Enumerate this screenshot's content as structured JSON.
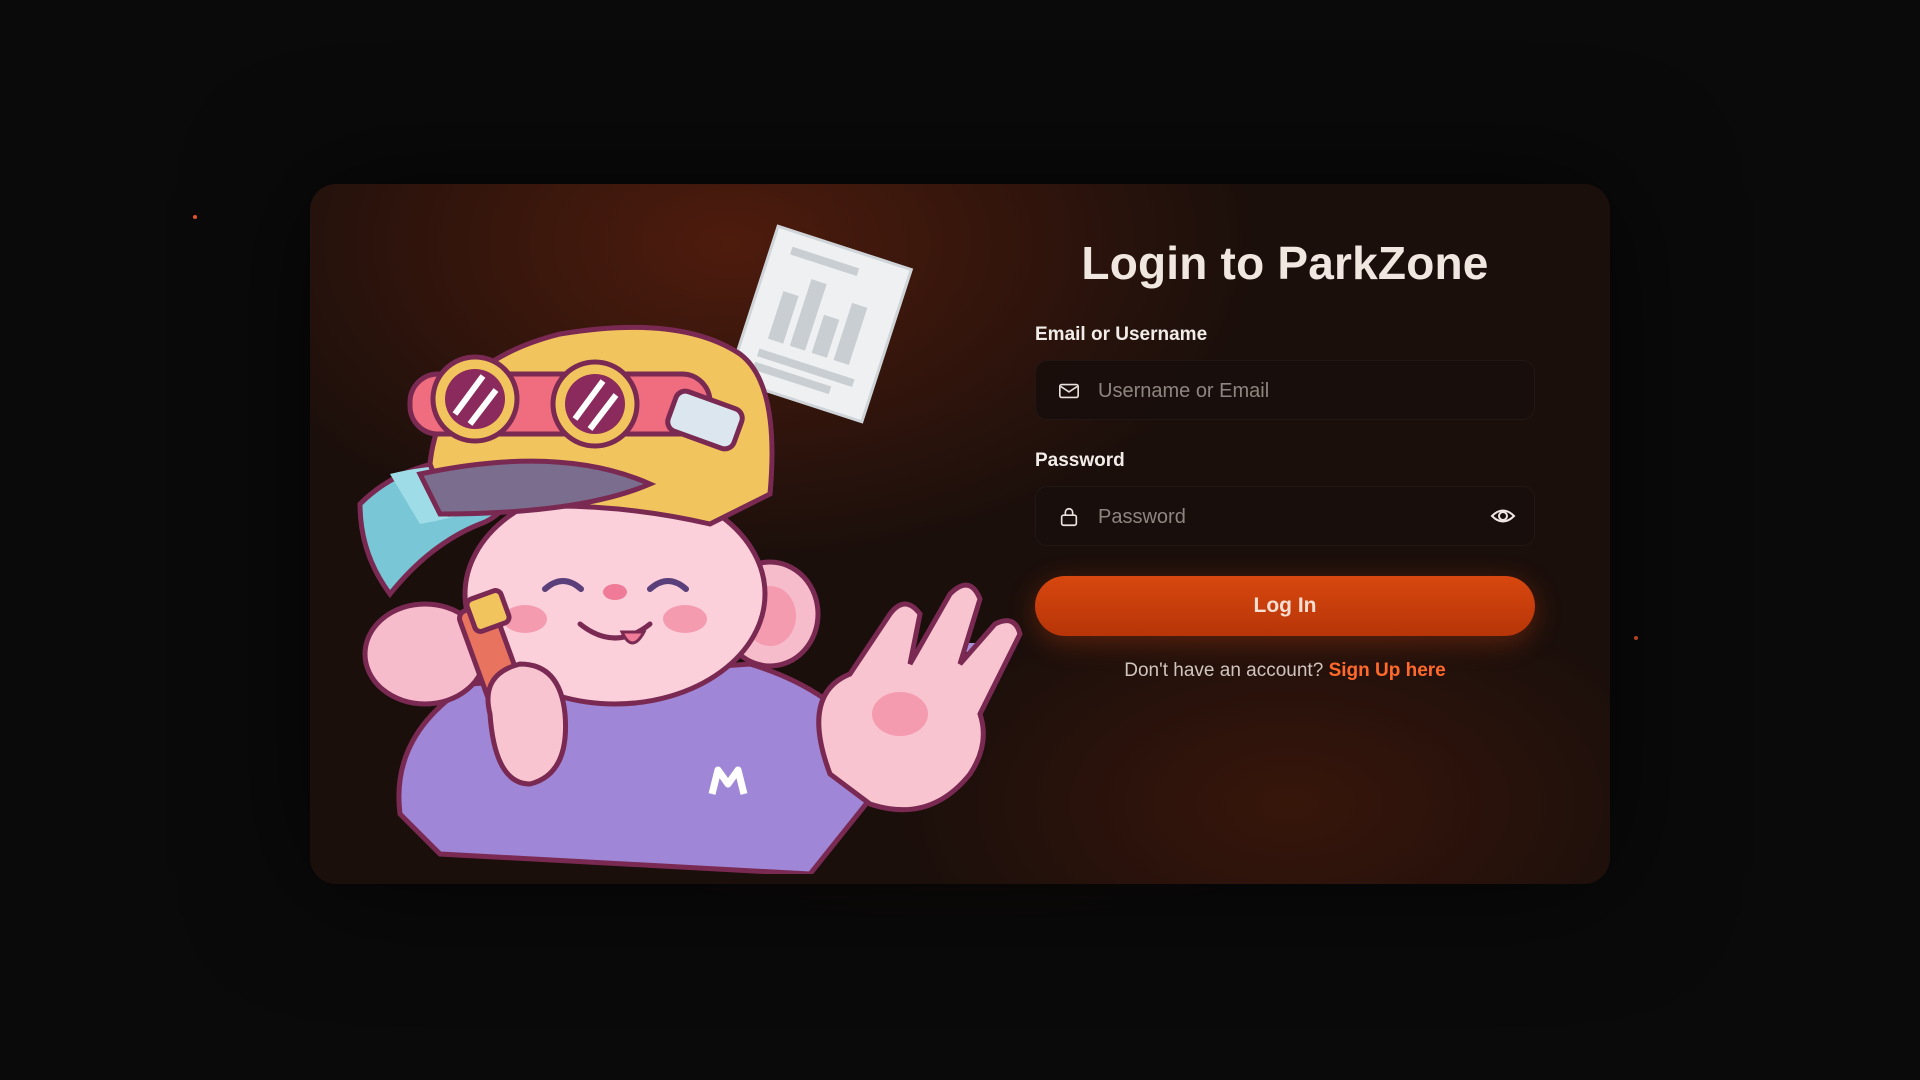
{
  "login": {
    "title": "Login to ParkZone",
    "email_label": "Email or Username",
    "email_placeholder": "Username or Email",
    "email_value": "",
    "password_label": "Password",
    "password_placeholder": "Password",
    "password_value": "",
    "submit_label": "Log In",
    "signup_prompt": "Don't have an account?",
    "signup_link": "Sign Up here"
  },
  "icons": {
    "email": "mail-icon",
    "password": "lock-icon",
    "toggle": "eye-icon"
  },
  "colors": {
    "accent": "#d8470f",
    "link": "#ff6a2b",
    "background": "#0b0a0a",
    "card": "#1b0f0b"
  }
}
